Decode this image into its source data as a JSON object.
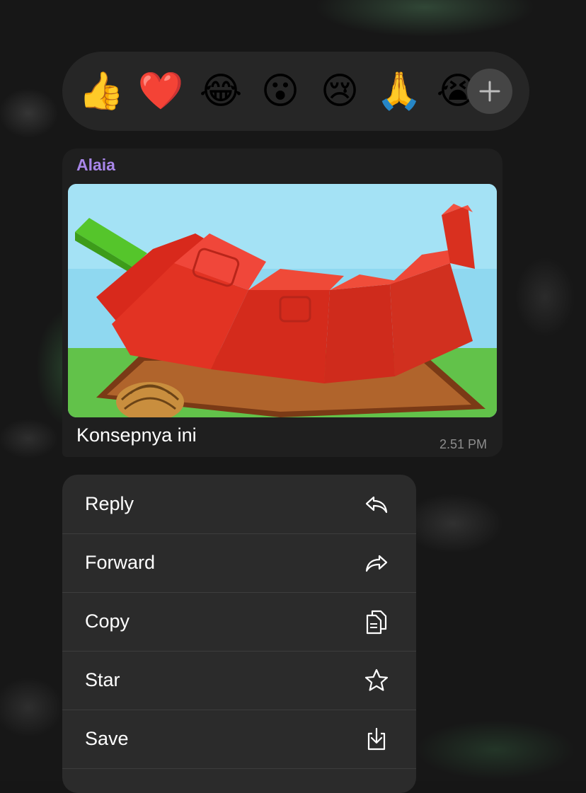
{
  "reactions": {
    "emojis": [
      {
        "name": "thumbs-up-emoji",
        "glyph": "👍"
      },
      {
        "name": "heart-emoji",
        "glyph": "❤️"
      },
      {
        "name": "tears-of-joy-emoji",
        "glyph": "😂"
      },
      {
        "name": "surprised-emoji",
        "glyph": "😮"
      },
      {
        "name": "sad-emoji",
        "glyph": "😢"
      },
      {
        "name": "folded-hands-emoji",
        "glyph": "🙏"
      },
      {
        "name": "crying-emoji",
        "glyph": "😭"
      }
    ],
    "add_icon": "plus-icon"
  },
  "message": {
    "sender": "Alaia",
    "sender_color": "#a886e8",
    "caption": "Konsepnya ini",
    "time": "2.51 PM"
  },
  "menu": {
    "items": [
      {
        "label": "Reply",
        "icon": "reply-icon"
      },
      {
        "label": "Forward",
        "icon": "forward-icon"
      },
      {
        "label": "Copy",
        "icon": "copy-icon"
      },
      {
        "label": "Star",
        "icon": "star-icon"
      },
      {
        "label": "Save",
        "icon": "save-icon"
      }
    ]
  }
}
